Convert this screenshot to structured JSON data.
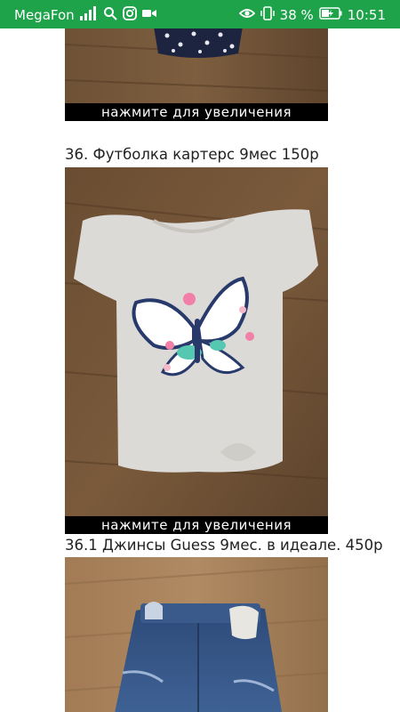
{
  "status_bar": {
    "carrier": "MegaFon",
    "battery": "38 %",
    "time": "10:51",
    "icons": [
      "signal-icon",
      "search-icon",
      "instagram-icon",
      "video-icon",
      "eye-icon",
      "vibrate-icon",
      "battery-icon"
    ]
  },
  "items": [
    {
      "zoom_label": "нажмите для увеличения"
    },
    {
      "caption": "36. Футболка картерс 9мес 150р",
      "zoom_label": "нажмите для увеличения"
    },
    {
      "caption": "36.1 Джинсы Guess 9мес. в идеале. 450р"
    }
  ],
  "colors": {
    "status_bar": "#1ea34a",
    "wood": "#6b4e33"
  }
}
